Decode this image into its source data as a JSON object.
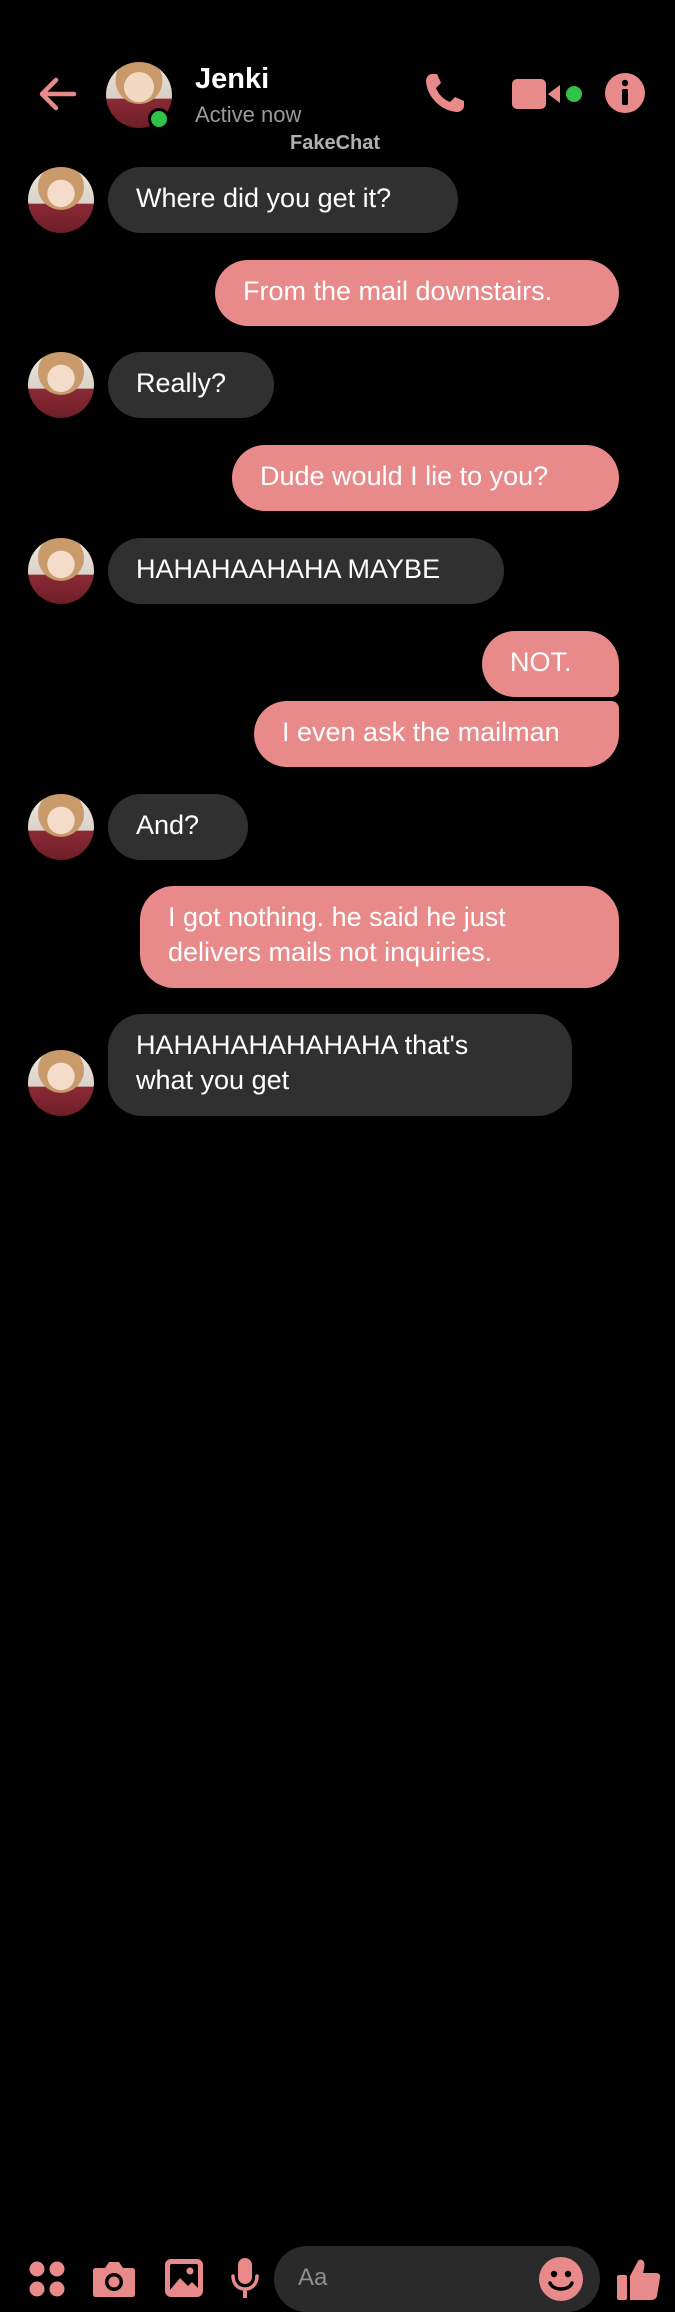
{
  "header": {
    "contact_name": "Jenki",
    "status": "Active now",
    "watermark": "FakeChat",
    "icons": [
      "back-arrow-icon",
      "phone-icon",
      "video-camera-icon",
      "info-icon"
    ]
  },
  "messages": [
    {
      "direction": "in",
      "lines": [
        "Where did you get it?"
      ]
    },
    {
      "direction": "out",
      "lines": [
        "From the mail downstairs."
      ]
    },
    {
      "direction": "in",
      "lines": [
        "Really?"
      ]
    },
    {
      "direction": "out",
      "lines": [
        "Dude would I lie to you?"
      ]
    },
    {
      "direction": "in",
      "lines": [
        "HAHAHAAHAHA MAYBE"
      ]
    },
    {
      "direction": "out",
      "lines": [
        "NOT."
      ]
    },
    {
      "direction": "out",
      "lines": [
        "I even ask the mailman"
      ]
    },
    {
      "direction": "in",
      "lines": [
        "And?"
      ]
    },
    {
      "direction": "out",
      "lines": [
        "I got nothing.  he said he just",
        "delivers mails not inquiries."
      ]
    },
    {
      "direction": "in",
      "lines": [
        "HAHAHAHAHAHAHA that's",
        "what you get"
      ]
    }
  ],
  "composer": {
    "placeholder": "Aa",
    "icons": [
      "apps-icon",
      "camera-icon",
      "image-icon",
      "microphone-icon",
      "emoji-icon",
      "thumbs-up-icon"
    ]
  },
  "colors": {
    "accent": "#e88a8a",
    "incoming_bubble": "#303030",
    "background": "#000000",
    "online": "#31c24a"
  }
}
